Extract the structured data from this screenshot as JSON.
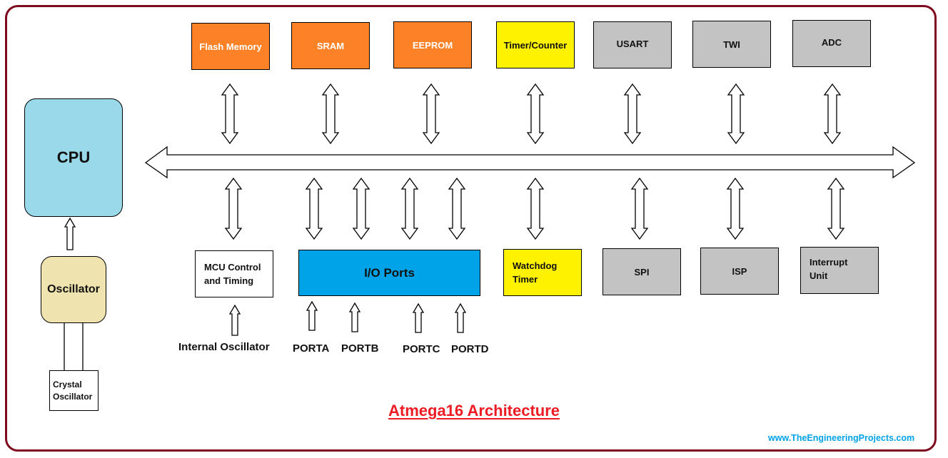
{
  "title": "Atmega16 Architecture",
  "website": "www.TheEngineeringProjects.com",
  "colors": {
    "frame": "#7f0a1e",
    "memory": "#fd8227",
    "timer": "#fff200",
    "peripheral": "#c3c3c3",
    "cpu": "#99d9ea",
    "oscillator": "#efe4b0",
    "io_ports": "#00a2e8",
    "title": "#ed1c24",
    "website": "#00a2e8"
  },
  "cpu": {
    "label": "CPU"
  },
  "oscillator": {
    "label": "Oscillator"
  },
  "crystal": {
    "label": "Crystal\nOscillator"
  },
  "bus": {
    "name": "data-bus",
    "direction": "bidirectional"
  },
  "top_blocks": [
    {
      "label": "Flash Memory",
      "category": "memory"
    },
    {
      "label": "SRAM",
      "category": "memory"
    },
    {
      "label": "EEPROM",
      "category": "memory"
    },
    {
      "label": "Timer/Counter",
      "category": "timer"
    },
    {
      "label": "USART",
      "category": "peripheral"
    },
    {
      "label": "TWI",
      "category": "peripheral"
    },
    {
      "label": "ADC",
      "category": "peripheral"
    }
  ],
  "bottom_blocks": [
    {
      "label": "MCU Control\nand Timing",
      "category": "control"
    },
    {
      "label": "I/O Ports",
      "category": "io"
    },
    {
      "label": "Watchdog\nTimer",
      "category": "timer"
    },
    {
      "label": "SPI",
      "category": "peripheral"
    },
    {
      "label": "ISP",
      "category": "peripheral"
    },
    {
      "label": "Interrupt\nUnit",
      "category": "peripheral"
    }
  ],
  "inputs": [
    {
      "label": "Internal Oscillator",
      "target": "MCU Control and Timing"
    },
    {
      "label": "PORTA",
      "target": "I/O Ports"
    },
    {
      "label": "PORTB",
      "target": "I/O Ports"
    },
    {
      "label": "PORTC",
      "target": "I/O Ports"
    },
    {
      "label": "PORTD",
      "target": "I/O Ports"
    }
  ]
}
